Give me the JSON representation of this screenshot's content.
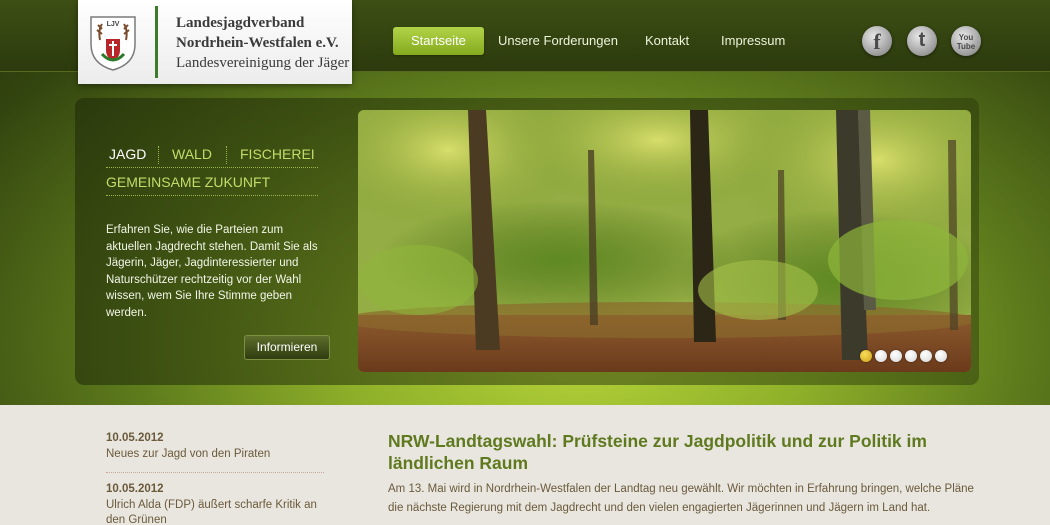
{
  "org": {
    "line1": "Landesjagdverband",
    "line2": "Nordrhein-Westfalen e.V.",
    "line3": "Landesvereinigung der Jäger",
    "crest_text": "LJV"
  },
  "nav": {
    "items": [
      {
        "label": "Startseite",
        "active": true
      },
      {
        "label": "Unsere Forderungen"
      },
      {
        "label": "Kontakt"
      },
      {
        "label": "Impressum"
      }
    ]
  },
  "social": {
    "facebook": {
      "icon": "facebook-icon",
      "glyph": "f"
    },
    "twitter": {
      "icon": "twitter-icon",
      "glyph": "t"
    },
    "youtube": {
      "icon": "youtube-icon",
      "glyph": "You Tube"
    }
  },
  "tagline": {
    "tags": [
      "JAGD",
      "WALD",
      "FISCHEREI"
    ],
    "row2": "GEMEINSAME ZUKUNFT"
  },
  "intro": {
    "text": "Erfahren Sie, wie die Parteien zum aktuellen Jagdrecht stehen. Damit Sie als Jägerin, Jäger, Jagdinteressierter und Naturschützer rechtzeitig vor der Wahl wissen, wem Sie Ihre Stimme geben werden.",
    "button": "Informieren"
  },
  "slider": {
    "slide_count": 6,
    "active_index": 0
  },
  "news": [
    {
      "date": "10.05.2012",
      "title": "Neues zur Jagd von den Piraten"
    },
    {
      "date": "10.05.2012",
      "title": "Ulrich Alda (FDP) äußert scharfe Kritik an den Grünen"
    }
  ],
  "article": {
    "title": "NRW-Landtagswahl: Prüfsteine zur Jagdpolitik und zur Politik im ländlichen Raum",
    "body": "Am 13. Mai wird in Nordrhein-Westfalen der Landtag neu gewählt. Wir möchten in Erfahrung bringen, welche Pläne die nächste Regierung mit dem Jagdrecht und den vielen engagierten Jägerinnen und Jägern im Land hat."
  },
  "colors": {
    "accent": "#8fb12a",
    "nav_active": "#9cc233",
    "text_brown": "#6a5a3a",
    "title_green": "#5f7a1e"
  }
}
